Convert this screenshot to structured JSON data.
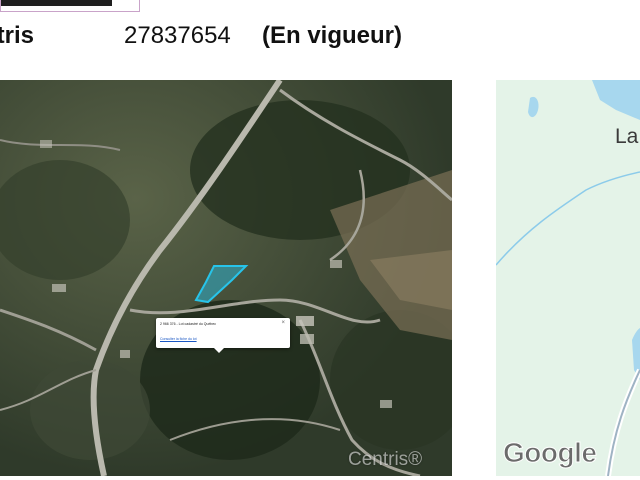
{
  "header": {
    "label": "ntris",
    "mls_number": "27837654",
    "status": "(En vigueur)"
  },
  "satellite_map": {
    "popup_title": "2 966 376 - Lot cadastré du Québec",
    "popup_link": "Consulter la fiche du lot",
    "popup_close": "×",
    "watermark": "Centris®",
    "highlight_color": "#27c4ea"
  },
  "road_map": {
    "place_label": "La",
    "logo": "Google"
  }
}
